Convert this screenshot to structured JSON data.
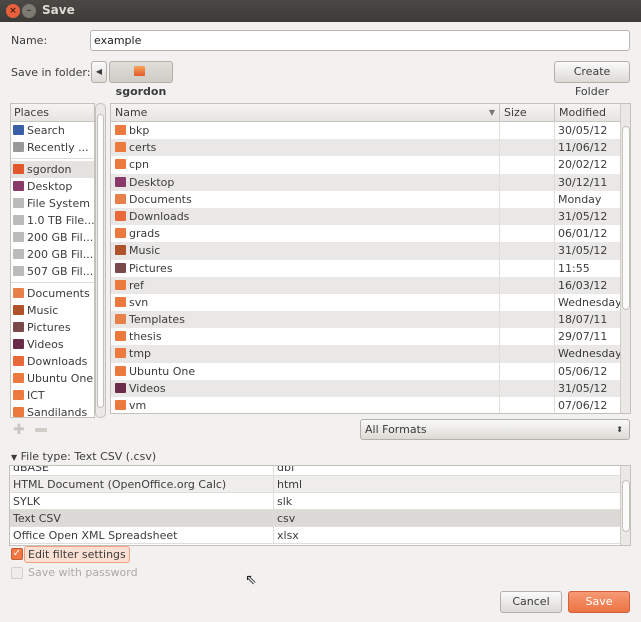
{
  "window": {
    "title": "Save",
    "close_icon": "close-icon",
    "minimize_icon": "minimize-icon"
  },
  "name_label": "Name:",
  "name_value": "example",
  "folder_label": "Save in folder:",
  "folder_crumb": "sgordon",
  "create_folder": "Create Folder",
  "places": {
    "header": "Places",
    "groups": [
      [
        {
          "label": "Search",
          "icon": "search-icon"
        },
        {
          "label": "Recently ...",
          "icon": "clock-icon"
        }
      ],
      [
        {
          "label": "sgordon",
          "icon": "home-folder-icon"
        },
        {
          "label": "Desktop",
          "icon": "desktop-icon"
        },
        {
          "label": "File System",
          "icon": "drive-icon"
        },
        {
          "label": "1.0 TB File...",
          "icon": "drive-icon"
        },
        {
          "label": "200 GB Fil...",
          "icon": "drive-icon"
        },
        {
          "label": "200 GB Fil...",
          "icon": "drive-icon"
        },
        {
          "label": "507 GB Fil...",
          "icon": "drive-icon"
        }
      ],
      [
        {
          "label": "Documents",
          "icon": "documents-folder-icon"
        },
        {
          "label": "Music",
          "icon": "music-folder-icon"
        },
        {
          "label": "Pictures",
          "icon": "pictures-folder-icon"
        },
        {
          "label": "Videos",
          "icon": "videos-folder-icon"
        },
        {
          "label": "Downloads",
          "icon": "downloads-folder-icon"
        },
        {
          "label": "Ubuntu One",
          "icon": "folder-icon"
        },
        {
          "label": "ICT",
          "icon": "folder-icon"
        },
        {
          "label": "Sandilands",
          "icon": "folder-icon"
        }
      ]
    ]
  },
  "files": {
    "columns": {
      "name": "Name",
      "size": "Size",
      "modified": "Modified"
    },
    "rows": [
      {
        "name": "bkp",
        "modified": "30/05/12"
      },
      {
        "name": "certs",
        "modified": "11/06/12"
      },
      {
        "name": "cpn",
        "modified": "20/02/12"
      },
      {
        "name": "Desktop",
        "modified": "30/12/11"
      },
      {
        "name": "Documents",
        "modified": "Monday"
      },
      {
        "name": "Downloads",
        "modified": "31/05/12"
      },
      {
        "name": "grads",
        "modified": "06/01/12"
      },
      {
        "name": "Music",
        "modified": "31/05/12"
      },
      {
        "name": "Pictures",
        "modified": "11:55"
      },
      {
        "name": "ref",
        "modified": "16/03/12"
      },
      {
        "name": "svn",
        "modified": "Wednesday"
      },
      {
        "name": "Templates",
        "modified": "18/07/11"
      },
      {
        "name": "thesis",
        "modified": "29/07/11"
      },
      {
        "name": "tmp",
        "modified": "Wednesday"
      },
      {
        "name": "Ubuntu One",
        "modified": "05/06/12"
      },
      {
        "name": "Videos",
        "modified": "31/05/12"
      },
      {
        "name": "vm",
        "modified": "07/06/12"
      }
    ]
  },
  "format_filter": "All Formats",
  "file_type": {
    "label": "File type: Text CSV (.csv)",
    "rows": [
      {
        "name": "dBASE",
        "ext": "dbf"
      },
      {
        "name": "HTML Document (OpenOffice.org Calc)",
        "ext": "html"
      },
      {
        "name": "SYLK",
        "ext": "slk"
      },
      {
        "name": "Text CSV",
        "ext": "csv",
        "selected": true
      },
      {
        "name": "Office Open XML Spreadsheet",
        "ext": "xlsx"
      }
    ]
  },
  "edit_filter": {
    "label": "Edit filter settings",
    "checked": true
  },
  "save_password": {
    "label": "Save with password",
    "checked": false,
    "enabled": false
  },
  "buttons": {
    "cancel": "Cancel",
    "save": "Save"
  },
  "colors": {
    "accent": "#f07746",
    "titlebar": "#3c3b37"
  }
}
